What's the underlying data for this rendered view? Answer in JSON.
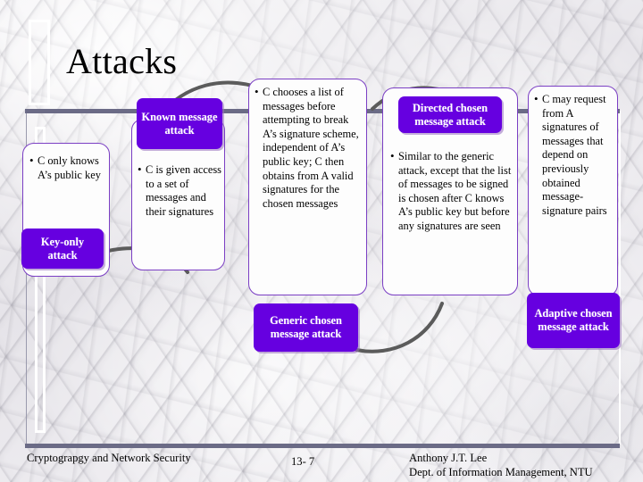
{
  "slide": {
    "title": "Attacks",
    "accent_purple": "#6600e0",
    "bar_color": "#6b6b86",
    "card_border": "#7b3fc4"
  },
  "cards": [
    {
      "id": "key-only",
      "bullet": "•",
      "text": "C only knows A’s public key"
    },
    {
      "id": "known-message",
      "bullet": "•",
      "text": "C is given access to a set of messages and their signatures"
    },
    {
      "id": "generic-chosen",
      "bullet": "•",
      "text": "C chooses a list of messages before attempting to break A’s signature scheme, independent of A’s public key; C then obtains from A valid signatures for the chosen messages"
    },
    {
      "id": "directed-chosen",
      "bullet": "•",
      "text": "Similar to the generic attack, except that the list of messages to be signed is chosen after C knows A’s public key but before any signatures are seen"
    },
    {
      "id": "adaptive-chosen",
      "bullet": "•",
      "text": "C may request from A signatures of messages that depend on previously obtained message-signature pairs"
    }
  ],
  "chips": [
    {
      "id": "known-message-attack",
      "label": "Known message attack"
    },
    {
      "id": "key-only-attack",
      "label": "Key-only attack"
    },
    {
      "id": "directed-chosen-attack",
      "label": "Directed chosen message attack"
    },
    {
      "id": "generic-chosen-attack",
      "label": "Generic chosen message attack"
    },
    {
      "id": "adaptive-chosen-attack",
      "label": "Adaptive chosen message attack"
    }
  ],
  "footer": {
    "left": "Cryptograpgy and Network Security",
    "page": "13- 7",
    "author": "Anthony J.T. Lee",
    "affiliation": "Dept. of Information Management, NTU"
  }
}
